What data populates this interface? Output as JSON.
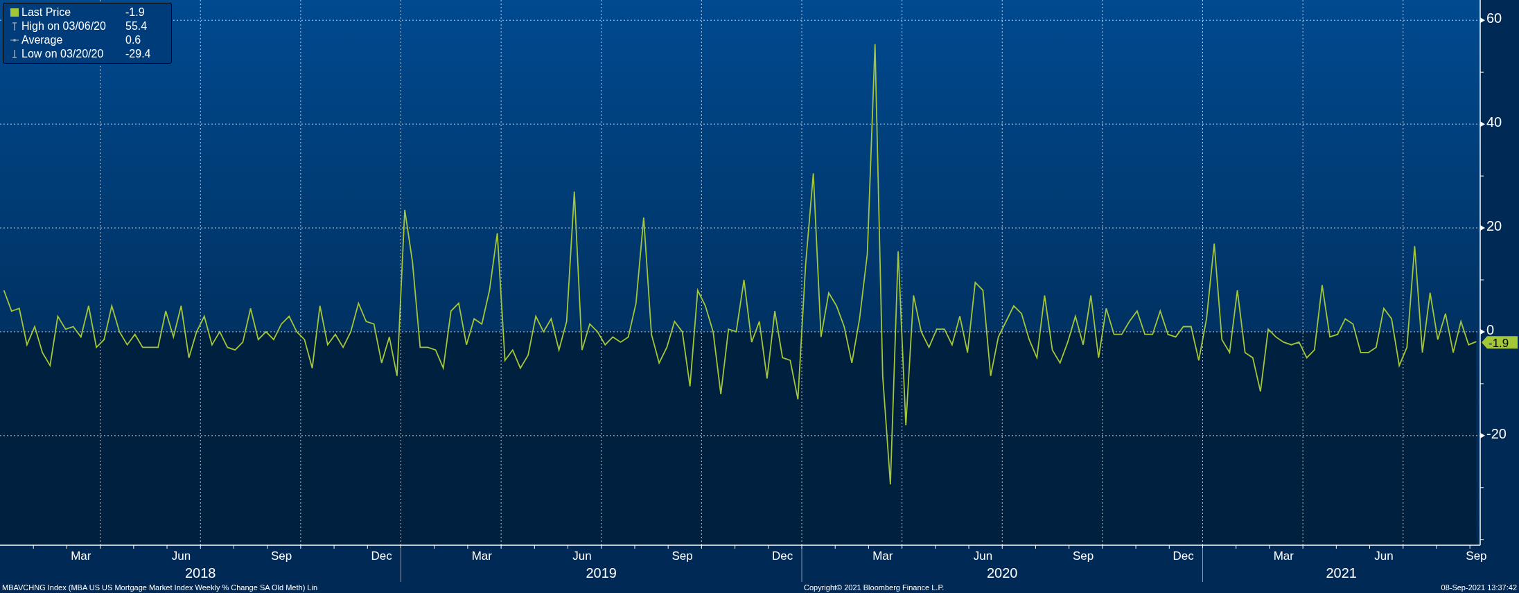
{
  "legend": [
    {
      "kind": "last",
      "value": "-1.9"
    },
    {
      "kind": "high",
      "label": "High on 03/06/20",
      "value": "55.4"
    },
    {
      "kind": "average",
      "label": "Average",
      "value": "0.6"
    },
    {
      "kind": "low",
      "label": "Low on 03/20/20",
      "value": "-29.4"
    }
  ],
  "last_price_badge": "-1.9",
  "chart_data": {
    "type": "line",
    "grid": true,
    "ylim": [
      -41.1,
      63.9
    ],
    "yticks": [
      -20,
      0,
      20,
      40,
      60
    ],
    "categories": [
      null,
      null,
      null,
      null,
      null,
      null,
      null,
      null,
      null,
      null,
      "Mar",
      null,
      null,
      null,
      null,
      null,
      null,
      null,
      null,
      null,
      null,
      null,
      null,
      "Jun",
      null,
      null,
      null,
      null,
      null,
      null,
      null,
      null,
      null,
      null,
      null,
      null,
      "Sep",
      null,
      null,
      null,
      null,
      null,
      null,
      null,
      null,
      null,
      null,
      null,
      null,
      "Dec",
      null,
      null,
      null,
      null,
      null,
      null,
      null,
      null,
      null,
      null,
      null,
      null,
      "Mar",
      null,
      null,
      null,
      null,
      null,
      null,
      null,
      null,
      null,
      null,
      null,
      null,
      "Jun",
      null,
      null,
      null,
      null,
      null,
      null,
      null,
      null,
      null,
      null,
      null,
      null,
      "Sep",
      null,
      null,
      null,
      null,
      null,
      null,
      null,
      null,
      null,
      null,
      null,
      null,
      "Dec",
      null,
      null,
      null,
      null,
      null,
      null,
      null,
      null,
      null,
      null,
      null,
      null,
      "Mar",
      null,
      null,
      null,
      null,
      null,
      null,
      null,
      null,
      null,
      null,
      null,
      null,
      "Jun",
      null,
      null,
      null,
      null,
      null,
      null,
      null,
      null,
      null,
      null,
      null,
      null,
      "Sep",
      null,
      null,
      null,
      null,
      null,
      null,
      null,
      null,
      null,
      null,
      null,
      null,
      "Dec",
      null,
      null,
      null,
      null,
      null,
      null,
      null,
      null,
      null,
      null,
      null,
      null,
      "Mar",
      null,
      null,
      null,
      null,
      null,
      null,
      null,
      null,
      null,
      null,
      null,
      null,
      "Jun",
      null,
      null,
      null,
      null,
      null,
      null,
      null,
      null,
      null,
      null,
      null,
      "Sep"
    ],
    "series": [
      {
        "name": "Last Price",
        "color": "#a4c639",
        "values": [
          8,
          4,
          4.5,
          -2.5,
          1,
          -4,
          -6.5,
          3,
          0.5,
          1,
          -1,
          5,
          -3,
          -1.5,
          5,
          0,
          -2.5,
          -0.5,
          -3,
          -3,
          -3,
          4,
          -1,
          5,
          -5,
          0,
          3,
          -2.5,
          0,
          -3,
          -3.5,
          -2,
          4.5,
          -1.5,
          0,
          -1.5,
          1.5,
          3,
          0,
          -1.5,
          -7,
          5,
          -2.5,
          -0.5,
          -3,
          0,
          5.5,
          2,
          1.5,
          -6,
          -1,
          -8.5,
          23.5,
          13.5,
          -3,
          -3,
          -3.5,
          -7,
          4,
          5.5,
          -2.5,
          2.5,
          1.5,
          8,
          19,
          -5.5,
          -3.5,
          -7,
          -4.5,
          3,
          0,
          2.5,
          -3.5,
          2,
          27,
          -3.5,
          1.5,
          0,
          -2.5,
          -1,
          -2,
          -1,
          5.5,
          22,
          -0.5,
          -6,
          -3,
          2,
          0,
          -10.5,
          8,
          5,
          0,
          -12,
          0.5,
          0,
          10,
          -2,
          2,
          -9,
          4,
          -5,
          -5.5,
          -13,
          13,
          30.5,
          -1,
          7.5,
          5,
          1,
          -6,
          2.5,
          15,
          55.4,
          -8.5,
          -29.4,
          15.5,
          -18,
          7,
          0,
          -3,
          0.5,
          0.5,
          -2.5,
          3,
          -4,
          9.5,
          8,
          -8.5,
          -1,
          2,
          5,
          3.5,
          -1.5,
          -5,
          7,
          -3.5,
          -6,
          -2,
          3,
          -2.5,
          7,
          -5,
          4.5,
          -0.5,
          -0.5,
          2,
          4,
          -0.5,
          -0.5,
          4,
          -0.5,
          -1,
          1,
          1,
          -5.5,
          2.5,
          17,
          -1.5,
          -4,
          8,
          -4,
          -5,
          -11.5,
          0.5,
          -1,
          -2,
          -2.5,
          -2,
          -5,
          -3.5,
          9,
          -1,
          -0.5,
          2.5,
          1.5,
          -4,
          -4,
          -3,
          4.5,
          2.5,
          -6.5,
          -3,
          16.5,
          -4,
          7.5,
          -1.5,
          3.5,
          -4,
          2,
          -2.5,
          -1.9
        ]
      }
    ]
  },
  "years": [
    "2018",
    "2019",
    "2020",
    "2021"
  ],
  "footer": {
    "description": "MBAVCHNG Index (MBA US US Mortgage Market Index Weekly % Change SA Old Meth) Lin",
    "copyright": "Copyright© 2021 Bloomberg Finance L.P.",
    "timestamp": "08-Sep-2021 13:37:42"
  }
}
